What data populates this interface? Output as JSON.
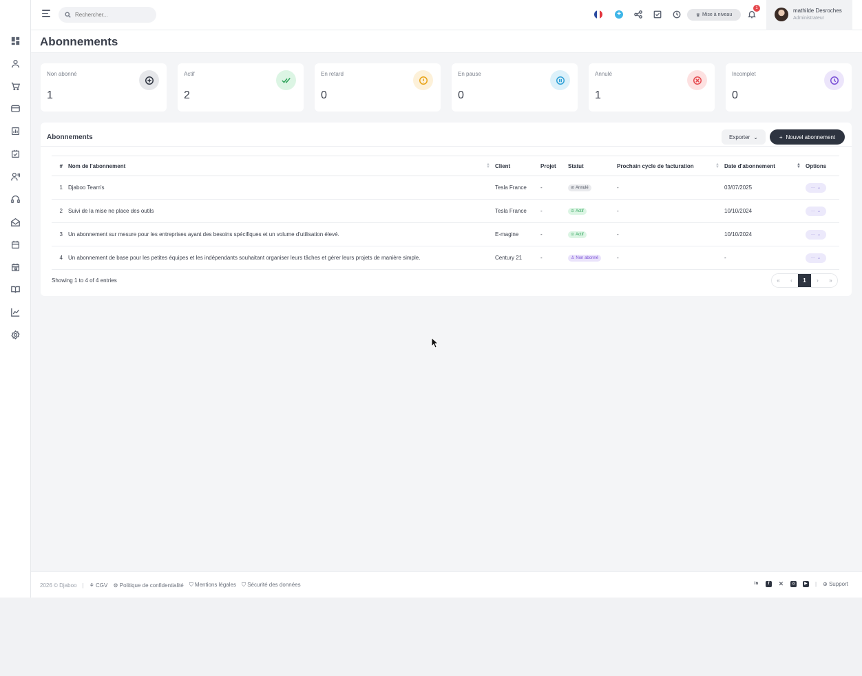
{
  "search": {
    "placeholder": "Rechercher..."
  },
  "header": {
    "upgrade_label": "Mise à niveau",
    "notification_count": "1"
  },
  "user": {
    "name": "mathilde Desroches",
    "role": "Administrateur"
  },
  "page": {
    "title": "Abonnements"
  },
  "stats": [
    {
      "label": "Non abonné",
      "value": "1",
      "icon": "plus-circle-icon",
      "color": "#5b6270",
      "bg": "#e6e7ea"
    },
    {
      "label": "Actif",
      "value": "2",
      "icon": "double-check-icon",
      "color": "#2ea35a",
      "bg": "#dcf5e4"
    },
    {
      "label": "En retard",
      "value": "0",
      "icon": "alert-circle-icon",
      "color": "#e8a317",
      "bg": "#fdf1d9"
    },
    {
      "label": "En pause",
      "value": "0",
      "icon": "pause-circle-icon",
      "color": "#2ea0d6",
      "bg": "#dcf1fa"
    },
    {
      "label": "Annulé",
      "value": "1",
      "icon": "x-circle-icon",
      "color": "#e5484d",
      "bg": "#fde1e1"
    },
    {
      "label": "Incomplet",
      "value": "0",
      "icon": "clock-icon",
      "color": "#7a4fd6",
      "bg": "#ece5fb"
    }
  ],
  "panel": {
    "title": "Abonnements",
    "export_label": "Exporter",
    "new_label": "Nouvel abonnement"
  },
  "table": {
    "headers": [
      "#",
      "Nom de l'abonnement",
      "Client",
      "Projet",
      "Statut",
      "Prochain cycle de facturation",
      "Date d'abonnement",
      "Options"
    ],
    "rows": [
      {
        "num": "1",
        "name": "Djaboo Team's",
        "client": "Tesla France",
        "project": "-",
        "status": "Annulé",
        "status_type": "annule",
        "next": "-",
        "date": "03/07/2025"
      },
      {
        "num": "2",
        "name": "Suivi de la mise ne place des outils",
        "client": "Tesla France",
        "project": "-",
        "status": "Actif",
        "status_type": "actif",
        "next": "-",
        "date": "10/10/2024"
      },
      {
        "num": "3",
        "name": "Un abonnement sur mesure pour les entreprises ayant des besoins spécifiques et un volume d'utilisation élevé.",
        "client": "E-magine",
        "project": "-",
        "status": "Actif",
        "status_type": "actif",
        "next": "-",
        "date": "10/10/2024"
      },
      {
        "num": "4",
        "name": "Un abonnement de base pour les petites équipes et les indépendants souhaitant organiser leurs tâches et gérer leurs projets de manière simple.",
        "client": "Century 21",
        "project": "-",
        "status": "Non abonné",
        "status_type": "non",
        "next": "-",
        "date": "-"
      }
    ],
    "showing": "Showing 1 to 4 of 4 entries",
    "pager": [
      "«",
      "‹",
      "1",
      "›",
      "»"
    ]
  },
  "footer": {
    "copyright": "2026 © Djaboo",
    "links": [
      "CGV",
      "Politique de confidentialité",
      "Mentions légales",
      "Sécurité des données"
    ],
    "support": "Support"
  }
}
